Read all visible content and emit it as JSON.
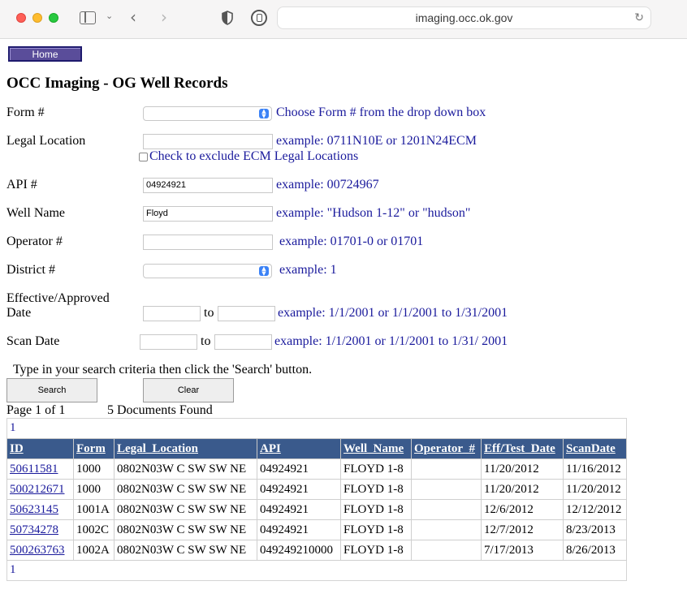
{
  "browser": {
    "url": "imaging.occ.ok.gov"
  },
  "page": {
    "home_label": "Home",
    "title": "OCC Imaging - OG Well Records"
  },
  "form": {
    "form_no": {
      "label": "Form #",
      "value": "",
      "hint": "Choose Form # from the drop down box"
    },
    "legal_location": {
      "label": "Legal Location",
      "value": "",
      "hint": "example: 0711N10E or 1201N24ECM"
    },
    "exclude_ecm": {
      "label": "Check to exclude ECM Legal Locations",
      "checked": false
    },
    "api": {
      "label": "API #",
      "value": "04924921",
      "hint": "example: 00724967"
    },
    "well_name": {
      "label": "Well Name",
      "value": "Floyd",
      "hint": "example: \"Hudson 1-12\" or \"hudson\""
    },
    "operator": {
      "label": "Operator #",
      "value": "",
      "hint": "example: 01701-0 or 01701"
    },
    "district": {
      "label": "District #",
      "value": "",
      "hint": "example: 1"
    },
    "effective": {
      "label_line1": "Effective/Approved",
      "label_line2": "Date",
      "from": "",
      "to_label": "to",
      "to": "",
      "hint": "example: 1/1/2001 or 1/1/2001 to 1/31/2001"
    },
    "scan_date": {
      "label": "Scan Date",
      "from": "",
      "to_label": "to",
      "to": "",
      "hint": "example: 1/1/2001 or 1/1/2001 to 1/31/ 2001"
    },
    "instructions": "Type in your search criteria then click the 'Search' button.",
    "search_label": "Search",
    "clear_label": "Clear"
  },
  "results": {
    "page_info": "Page 1 of 1",
    "found": "5 Documents Found",
    "pager_top": "1",
    "pager_bottom": "1",
    "columns": [
      "ID",
      "Form",
      "Legal_Location",
      "API",
      "Well_Name",
      "Operator_#",
      "Eff/Test_Date",
      "ScanDate"
    ],
    "rows": [
      [
        "50611581",
        "1000",
        "0802N03W C SW SW NE",
        "04924921",
        "FLOYD 1-8",
        "",
        "11/20/2012",
        "11/16/2012"
      ],
      [
        "500212671",
        "1000",
        "0802N03W C SW SW NE",
        "04924921",
        "FLOYD 1-8",
        "",
        "11/20/2012",
        "11/20/2012"
      ],
      [
        "50623145",
        "1001A",
        "0802N03W C SW SW NE",
        "04924921",
        "FLOYD 1-8",
        "",
        "12/6/2012",
        "12/12/2012"
      ],
      [
        "50734278",
        "1002C",
        "0802N03W C SW SW NE",
        "04924921",
        "FLOYD 1-8",
        "",
        "12/7/2012",
        "8/23/2013"
      ],
      [
        "500263763",
        "1002A",
        "0802N03W C SW SW NE",
        "049249210000",
        "FLOYD 1-8",
        "",
        "7/17/2013",
        "8/26/2013"
      ]
    ]
  }
}
